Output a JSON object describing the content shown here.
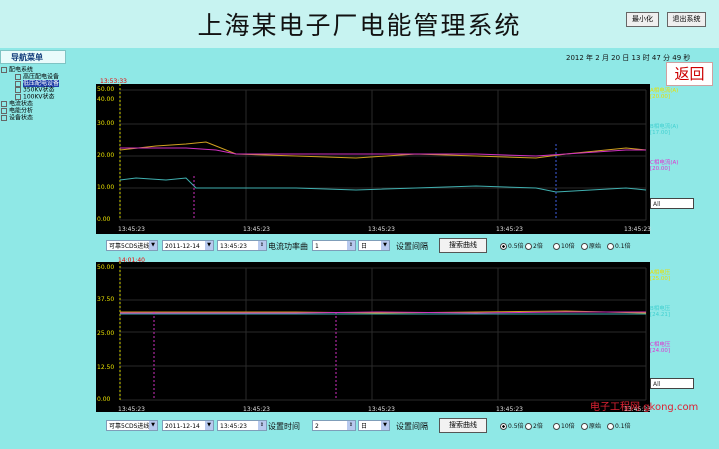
{
  "header": {
    "title": "上海某电子厂电能管理系统",
    "minimize_label": "最小化",
    "exit_label": "退出系统"
  },
  "nav": {
    "title": "导航菜单",
    "items": [
      "配电系统",
      "高压配电设备",
      "低压配电设备",
      "350KV状态",
      "100KV状态",
      "电流状态",
      "电能分析",
      "设备状态"
    ]
  },
  "datetime": "2012  年 2  月 20 日 13 时 47 分 49 秒",
  "back_label": "返回",
  "chart1": {
    "time_marker": "13:53:33",
    "ylabels": [
      "50.00",
      "40.00",
      "30.00",
      "20.00",
      "10.00",
      "0.00"
    ],
    "xlabels": [
      "13:45:23",
      "13:45:23",
      "13:45:23",
      "13:45:23",
      "13:45:23"
    ],
    "legend": [
      "A相电流(A)",
      "[20.00]",
      "B相电流(A)",
      "[17.00]",
      "C相电流(A)",
      "[20.00]"
    ],
    "box": "All"
  },
  "chart2": {
    "time_marker": "14:01:40",
    "ylabels": [
      "50.00",
      "37.50",
      "25.00",
      "12.50",
      "0.00"
    ],
    "xlabels": [
      "13:45:23",
      "13:45:23",
      "13:45:23",
      "13:45:23",
      "13:45:23"
    ],
    "legend": [
      "A相电压",
      "[25.00]",
      "B相电压",
      "[24.21]",
      "C相电压",
      "[24.00]"
    ],
    "box": "All"
  },
  "controls1": {
    "select": "可靠5CDS进线",
    "date": "2011-12-14",
    "time": "13:45:23",
    "metric_label": "电流功率曲",
    "interval_value": "1",
    "interval_unit": "日",
    "interval_label": "设置间隔",
    "search_label": "搜索曲线",
    "radios": [
      "0.5倍",
      "2倍",
      "10倍",
      "原始",
      "0.1倍"
    ]
  },
  "controls2": {
    "select": "可靠5CDS进线",
    "date": "2011-12-14",
    "time": "13:45:23",
    "metric_label": "设置时间",
    "interval_value": "2",
    "interval_unit": "日",
    "interval_label": "设置间隔",
    "search_label": "搜索曲线",
    "radios": [
      "0.5倍",
      "2倍",
      "10倍",
      "原始",
      "0.1倍"
    ]
  },
  "watermark": "电子工程网 gkong.com"
}
